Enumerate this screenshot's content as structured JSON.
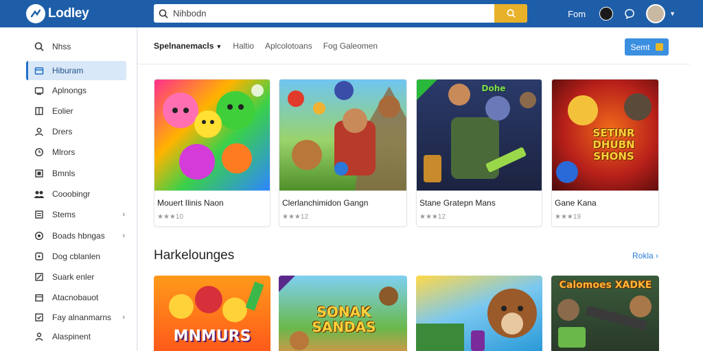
{
  "header": {
    "logo_text": "Lodley",
    "search_value": "Nihbodn",
    "link": "Fom"
  },
  "sidebar": {
    "items": [
      {
        "label": "Nhss",
        "icon": "search-icon"
      },
      {
        "label": "Hiburam",
        "icon": "home-icon",
        "active": true
      },
      {
        "label": "Aplnongs",
        "icon": "apps-icon"
      },
      {
        "label": "Eolier",
        "icon": "grid-icon"
      },
      {
        "label": "Drers",
        "icon": "user-icon"
      },
      {
        "label": "Mlrors",
        "icon": "clock-icon"
      },
      {
        "label": "Bmnls",
        "icon": "film-icon"
      },
      {
        "label": "Cooobingr",
        "icon": "people-icon"
      },
      {
        "label": "Stems",
        "icon": "list-icon",
        "chevron": true
      },
      {
        "label": "Boads hbngas",
        "icon": "globe-icon",
        "chevron": true
      },
      {
        "label": "Dog cblanlen",
        "icon": "gamepad-icon"
      },
      {
        "label": "Suark enler",
        "icon": "arrow-icon"
      },
      {
        "label": "Atacnobauot",
        "icon": "calendar-icon"
      },
      {
        "label": "Fay alnanmarns",
        "icon": "tag-icon",
        "chevron": true
      },
      {
        "label": "Alaspinent",
        "icon": "person-icon"
      }
    ]
  },
  "subnav": {
    "tabs": [
      "Spelnanemacls",
      "Haltio",
      "Aplcolotoans",
      "Fog Galeomen"
    ],
    "button": "Semt"
  },
  "featured": [
    {
      "title": "Mouert Ilinis Naon",
      "rating": "★★★10"
    },
    {
      "title": "Clerlanchimidon Gangn",
      "rating": "★★★12"
    },
    {
      "title": "Stane Gratepn Mans",
      "rating": "★★★12"
    },
    {
      "title": "Gane Kana",
      "rating": "★★★19"
    }
  ],
  "featured_art": {
    "third": "Dohe",
    "fourth": "SETINR DHUBN SHONS"
  },
  "section": {
    "title": "Harkelounges",
    "more": "Rokla"
  },
  "second_row_art": [
    "MNMURS",
    "SONAK SANDAS",
    "",
    "Calomoes XADKE"
  ],
  "colors": {
    "topbar": "#1e5ea8",
    "accent": "#e8b12a",
    "active": "#d9e8f8",
    "link": "#2a7ed6"
  }
}
